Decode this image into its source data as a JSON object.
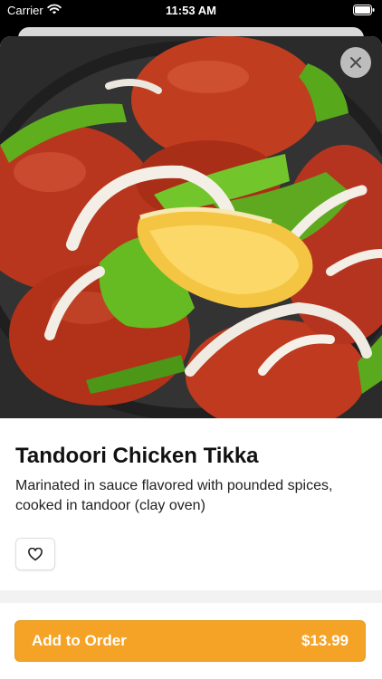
{
  "status_bar": {
    "carrier": "Carrier",
    "time": "11:53 AM",
    "wifi_icon": "wifi-icon",
    "battery_icon": "battery-icon"
  },
  "item": {
    "image_alt": "Tandoori chicken tikka with green peppers, onion and lemon",
    "name": "Tandoori Chicken Tikka",
    "description": "Marinated in sauce flavored with pounded spices, cooked in tandoor (clay oven)"
  },
  "icons": {
    "close": "close-icon",
    "favorite": "heart-icon"
  },
  "order": {
    "label": "Add to Order",
    "price": "$13.99"
  },
  "colors": {
    "accent": "#f5a326",
    "background": "#ffffff",
    "status_bar": "#000000"
  }
}
